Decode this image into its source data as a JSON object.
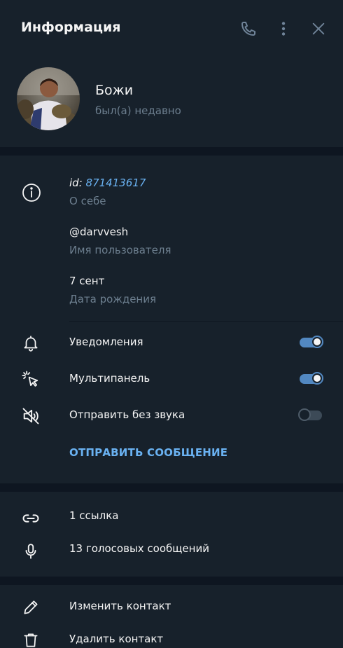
{
  "header": {
    "title": "Информация"
  },
  "profile": {
    "name": "Божи",
    "status": "был(а) недавно"
  },
  "info": {
    "id_prefix": "id:",
    "id_value": "871413617",
    "bio_label": "О себе",
    "username": "@darvvesh",
    "username_label": "Имя пользователя",
    "birthday": "7 сент",
    "birthday_label": "Дата рождения"
  },
  "settings": {
    "notifications": {
      "label": "Уведомления",
      "enabled": true
    },
    "multipanel": {
      "label": "Мультипанель",
      "enabled": true
    },
    "silent": {
      "label": "Отправить без звука",
      "enabled": false
    },
    "send_message": "ОТПРАВИТЬ СООБЩЕНИЕ"
  },
  "media": {
    "links": "1 ссылка",
    "voice": "13 голосовых сообщений"
  },
  "actions": {
    "edit": "Изменить контакт",
    "delete": "Удалить контакт"
  },
  "colors": {
    "background": "#17212b",
    "separator": "#0e1621",
    "accent": "#6ab2f2",
    "toggle_on": "#5288c1",
    "muted_text": "#6d7f8f"
  },
  "icons": [
    "phone-icon",
    "more-vertical-icon",
    "close-icon",
    "info-icon",
    "bell-icon",
    "cursor-click-icon",
    "volume-off-icon",
    "link-icon",
    "microphone-icon",
    "pencil-icon",
    "trash-icon"
  ]
}
